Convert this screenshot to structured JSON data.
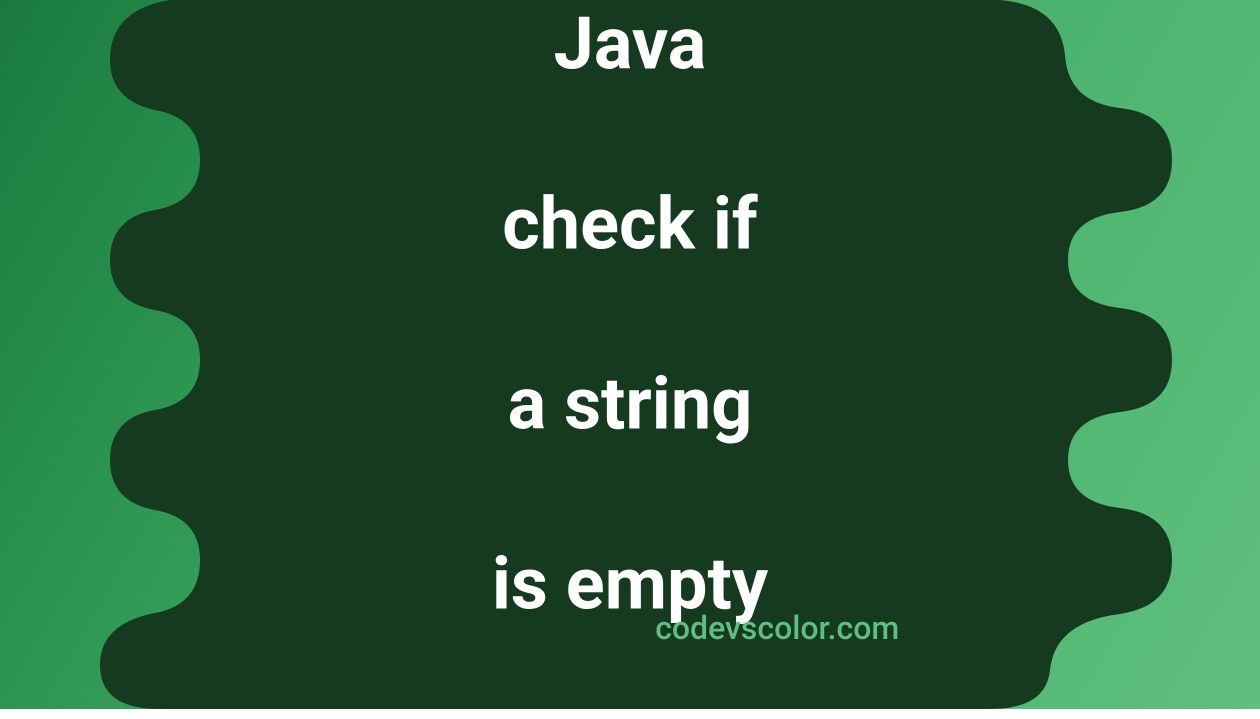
{
  "title": {
    "line1": "Java",
    "line2": "check if",
    "line3": "a string",
    "line4": "is empty"
  },
  "footer": "codevscolor.com",
  "colors": {
    "bgGradientStart": "#1a7a3e",
    "bgGradientEnd": "#5fbf7e",
    "blobColor": "#163a1f",
    "titleColor": "#ffffff",
    "footerColor": "#5fbf7e"
  }
}
